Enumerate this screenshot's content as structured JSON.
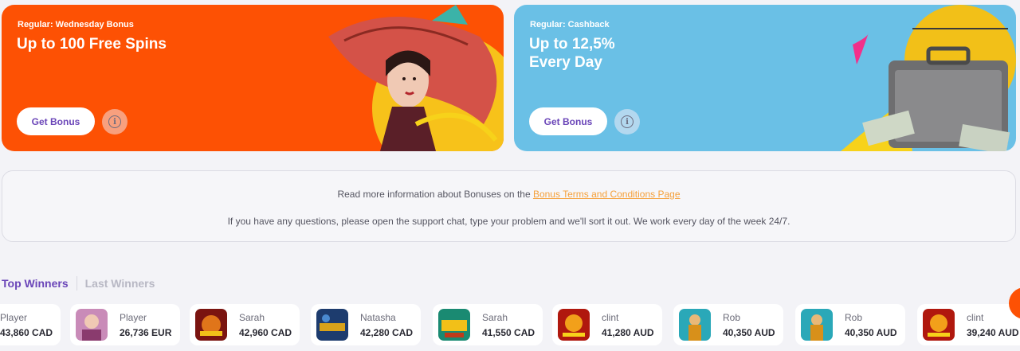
{
  "promos": [
    {
      "tag": "Regular: Wednesday Bonus",
      "title": "Up to 100 Free Spins",
      "button": "Get Bonus",
      "info_icon": "info-icon",
      "color": "#fd5104"
    },
    {
      "tag": "Regular: Cashback",
      "title": "Up to 12,5%\nEvery Day",
      "button": "Get Bonus",
      "info_icon": "info-icon",
      "color": "#6ac0e6"
    }
  ],
  "info": {
    "line1_prefix": "Read more information about Bonuses on the ",
    "line1_link": "Bonus Terms and Conditions Page",
    "line2": "If you have any questions, please open the support chat, type your problem and we'll sort it out. We work every day of the week 24/7."
  },
  "winners_tabs": {
    "top": "Top Winners",
    "last": "Last Winners"
  },
  "winners": [
    {
      "name": "Player",
      "amount": "43,860 CAD"
    },
    {
      "name": "Player",
      "amount": "26,736 EUR"
    },
    {
      "name": "Sarah",
      "amount": "42,960 CAD"
    },
    {
      "name": "Natasha",
      "amount": "42,280 CAD"
    },
    {
      "name": "Sarah",
      "amount": "41,550 CAD"
    },
    {
      "name": "clint",
      "amount": "41,280 AUD"
    },
    {
      "name": "Rob",
      "amount": "40,350 AUD"
    },
    {
      "name": "Rob",
      "amount": "40,350 AUD"
    },
    {
      "name": "clint",
      "amount": "39,240 AUD"
    }
  ],
  "colors": {
    "accent": "#6a45b8",
    "link": "#f5a03a",
    "orange": "#fd5104",
    "blue": "#6ac0e6"
  }
}
